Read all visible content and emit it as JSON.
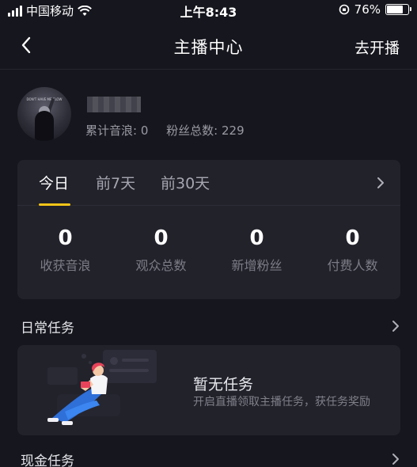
{
  "status_bar": {
    "carrier": "中国移动",
    "time": "上午8:43",
    "battery_percent": "76%",
    "battery_level": 0.76
  },
  "nav": {
    "title": "主播中心",
    "action": "去开播",
    "back_icon": "chevron-left-icon"
  },
  "profile": {
    "avatar_text": "DON'T HAVE ME SLOW",
    "accumulated_label": "累计音浪: 0",
    "fans_label": "粉丝总数: 229"
  },
  "stats": {
    "tabs": [
      "今日",
      "前7天",
      "前30天"
    ],
    "active_tab": 0,
    "metrics": [
      {
        "value": "0",
        "label": "收获音浪"
      },
      {
        "value": "0",
        "label": "观众总数"
      },
      {
        "value": "0",
        "label": "新增粉丝"
      },
      {
        "value": "0",
        "label": "付费人数"
      }
    ]
  },
  "daily_tasks": {
    "title": "日常任务",
    "empty_title": "暂无任务",
    "empty_desc": "开启直播领取主播任务，获任务奖励"
  },
  "cash_tasks": {
    "title": "现金任务"
  },
  "colors": {
    "background": "#16161e",
    "card": "#22222b",
    "accent": "#f5c518",
    "illustration_blue": "#2f6fd8",
    "illustration_pink": "#e8435a"
  }
}
